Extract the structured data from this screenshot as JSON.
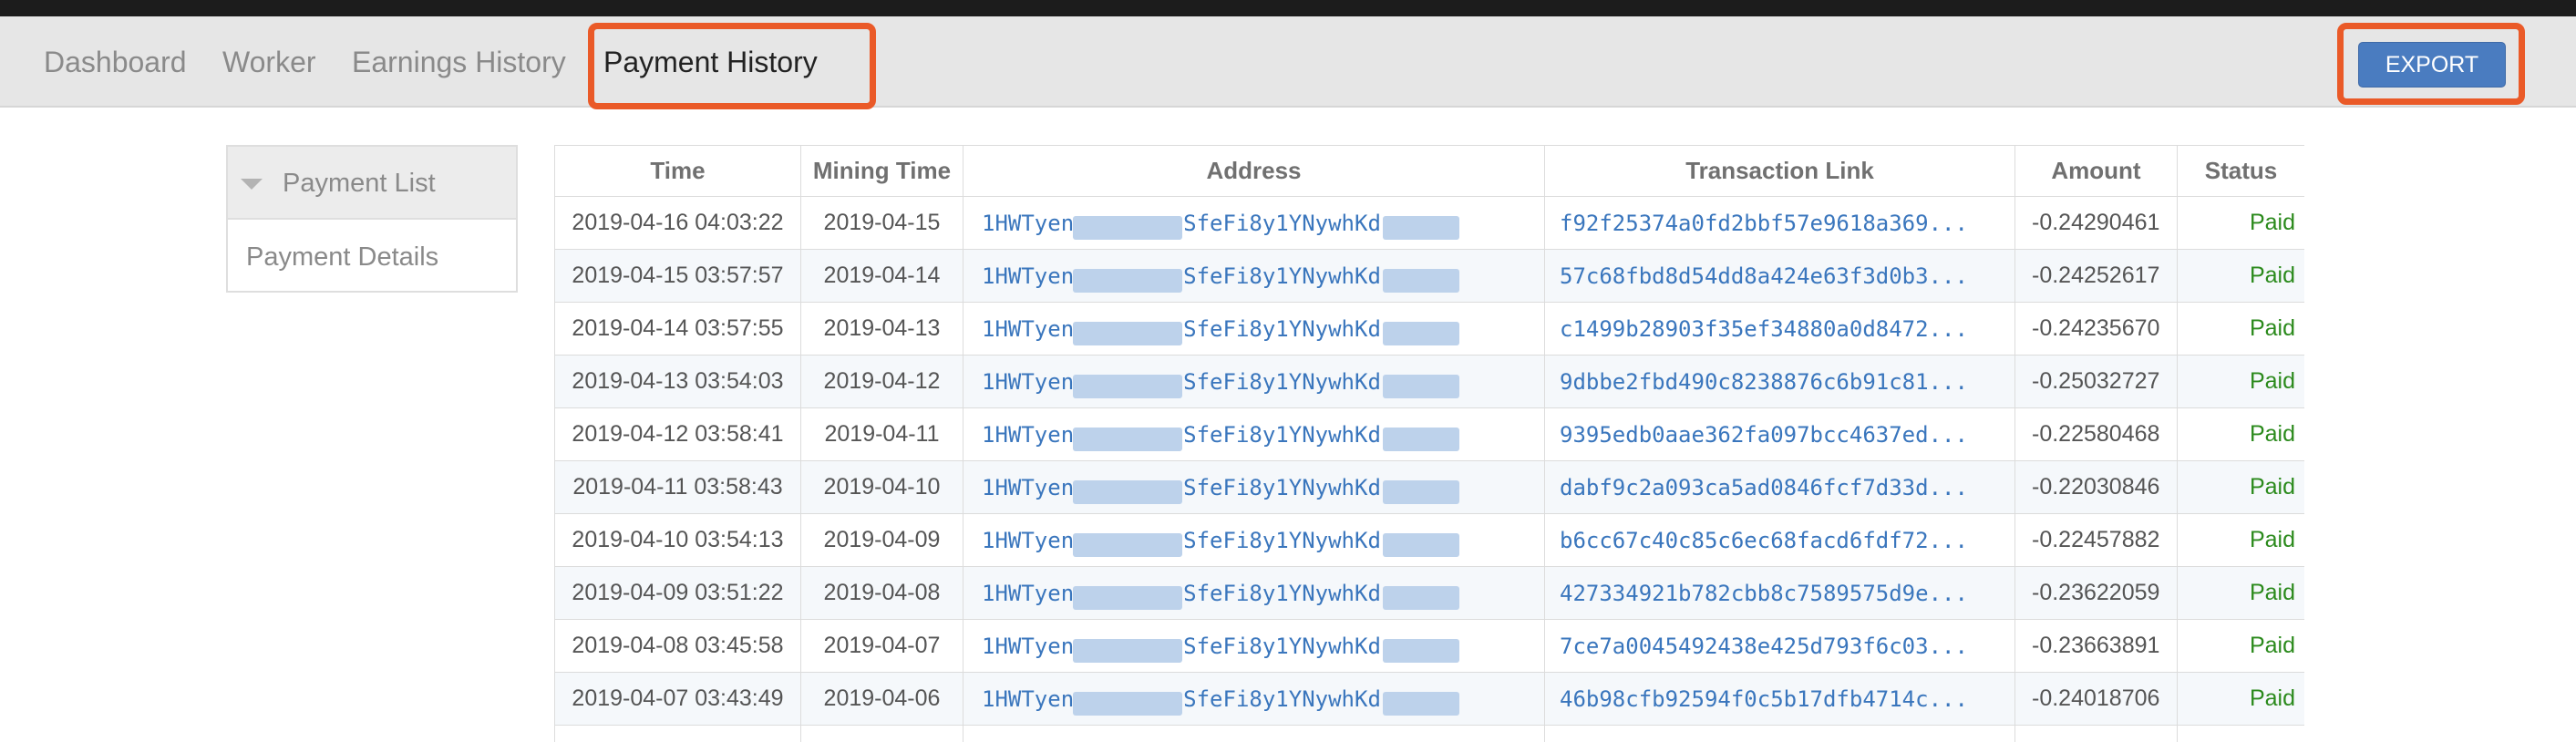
{
  "nav": {
    "items": [
      "Dashboard",
      "Worker",
      "Earnings History",
      "Payment History"
    ],
    "active_index": 3,
    "export_label": "EXPORT"
  },
  "sidebar": {
    "header_label": "Payment List",
    "items": [
      "Payment Details"
    ]
  },
  "table": {
    "columns": [
      "Time",
      "Mining Time",
      "Address",
      "Transaction Link",
      "Amount",
      "Status"
    ],
    "rows": [
      {
        "time": "2019-04-16 04:03:22",
        "mining_time": "2019-04-15",
        "address_start": "1HWTyen",
        "address_end": "SfeFi8y1YNywhKd",
        "tx": "f92f25374a0fd2bbf57e9618a369...",
        "amount": "-0.24290461",
        "status": "Paid"
      },
      {
        "time": "2019-04-15 03:57:57",
        "mining_time": "2019-04-14",
        "address_start": "1HWTyen",
        "address_end": "SfeFi8y1YNywhKd",
        "tx": "57c68fbd8d54dd8a424e63f3d0b3...",
        "amount": "-0.24252617",
        "status": "Paid"
      },
      {
        "time": "2019-04-14 03:57:55",
        "mining_time": "2019-04-13",
        "address_start": "1HWTyen",
        "address_end": "SfeFi8y1YNywhKd",
        "tx": "c1499b28903f35ef34880a0d8472...",
        "amount": "-0.24235670",
        "status": "Paid"
      },
      {
        "time": "2019-04-13 03:54:03",
        "mining_time": "2019-04-12",
        "address_start": "1HWTyen",
        "address_end": "SfeFi8y1YNywhKd",
        "tx": "9dbbe2fbd490c8238876c6b91c81...",
        "amount": "-0.25032727",
        "status": "Paid"
      },
      {
        "time": "2019-04-12 03:58:41",
        "mining_time": "2019-04-11",
        "address_start": "1HWTyen",
        "address_end": "SfeFi8y1YNywhKd",
        "tx": "9395edb0aae362fa097bcc4637ed...",
        "amount": "-0.22580468",
        "status": "Paid"
      },
      {
        "time": "2019-04-11 03:58:43",
        "mining_time": "2019-04-10",
        "address_start": "1HWTyen",
        "address_end": "SfeFi8y1YNywhKd",
        "tx": "dabf9c2a093ca5ad0846fcf7d33d...",
        "amount": "-0.22030846",
        "status": "Paid"
      },
      {
        "time": "2019-04-10 03:54:13",
        "mining_time": "2019-04-09",
        "address_start": "1HWTyen",
        "address_end": "SfeFi8y1YNywhKd",
        "tx": "b6cc67c40c85c6ec68facd6fdf72...",
        "amount": "-0.22457882",
        "status": "Paid"
      },
      {
        "time": "2019-04-09 03:51:22",
        "mining_time": "2019-04-08",
        "address_start": "1HWTyen",
        "address_end": "SfeFi8y1YNywhKd",
        "tx": "427334921b782cbb8c7589575d9e...",
        "amount": "-0.23622059",
        "status": "Paid"
      },
      {
        "time": "2019-04-08 03:45:58",
        "mining_time": "2019-04-07",
        "address_start": "1HWTyen",
        "address_end": "SfeFi8y1YNywhKd",
        "tx": "7ce7a0045492438e425d793f6c03...",
        "amount": "-0.23663891",
        "status": "Paid"
      },
      {
        "time": "2019-04-07 03:43:49",
        "mining_time": "2019-04-06",
        "address_start": "1HWTyen",
        "address_end": "SfeFi8y1YNywhKd",
        "tx": "46b98cfb92594f0c5b17dfb4714c...",
        "amount": "-0.24018706",
        "status": "Paid"
      }
    ]
  },
  "colors": {
    "accent_button": "#4a7cc0",
    "highlight_outline": "#ea5a28",
    "link": "#3a76bd",
    "status_paid": "#2b8a1c"
  }
}
